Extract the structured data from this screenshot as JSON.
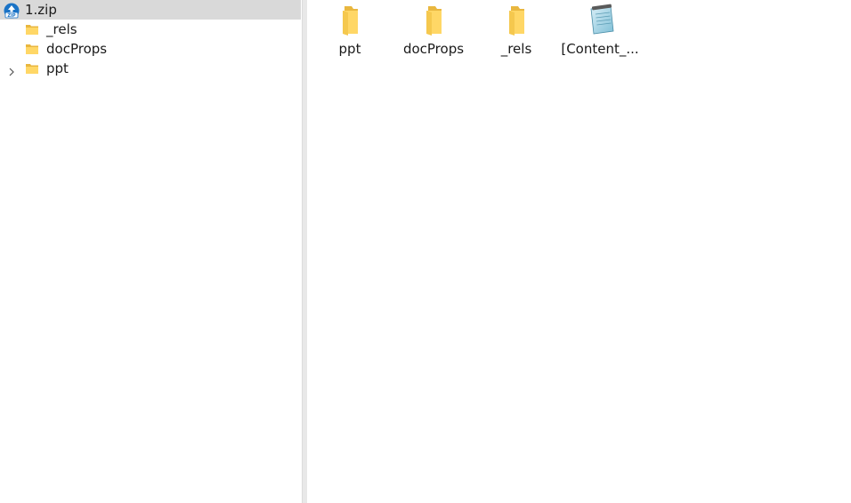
{
  "tree": {
    "root": {
      "label": "1.zip",
      "icon": "zip-archive-icon"
    },
    "items": [
      {
        "label": "_rels",
        "icon": "folder-icon",
        "has_children": false
      },
      {
        "label": "docProps",
        "icon": "folder-icon",
        "has_children": false
      },
      {
        "label": "ppt",
        "icon": "folder-icon",
        "has_children": true
      }
    ]
  },
  "content": {
    "items": [
      {
        "label": "ppt",
        "icon": "folder-icon"
      },
      {
        "label": "docProps",
        "icon": "folder-icon"
      },
      {
        "label": "_rels",
        "icon": "folder-icon"
      },
      {
        "label": "[Content_...",
        "icon": "notepad-file-icon"
      }
    ]
  },
  "colors": {
    "selected_row": "#d9d9d9",
    "folder_yellow": "#ffd766",
    "folder_shade": "#e9b73f",
    "zip_blue": "#1a73c6"
  }
}
